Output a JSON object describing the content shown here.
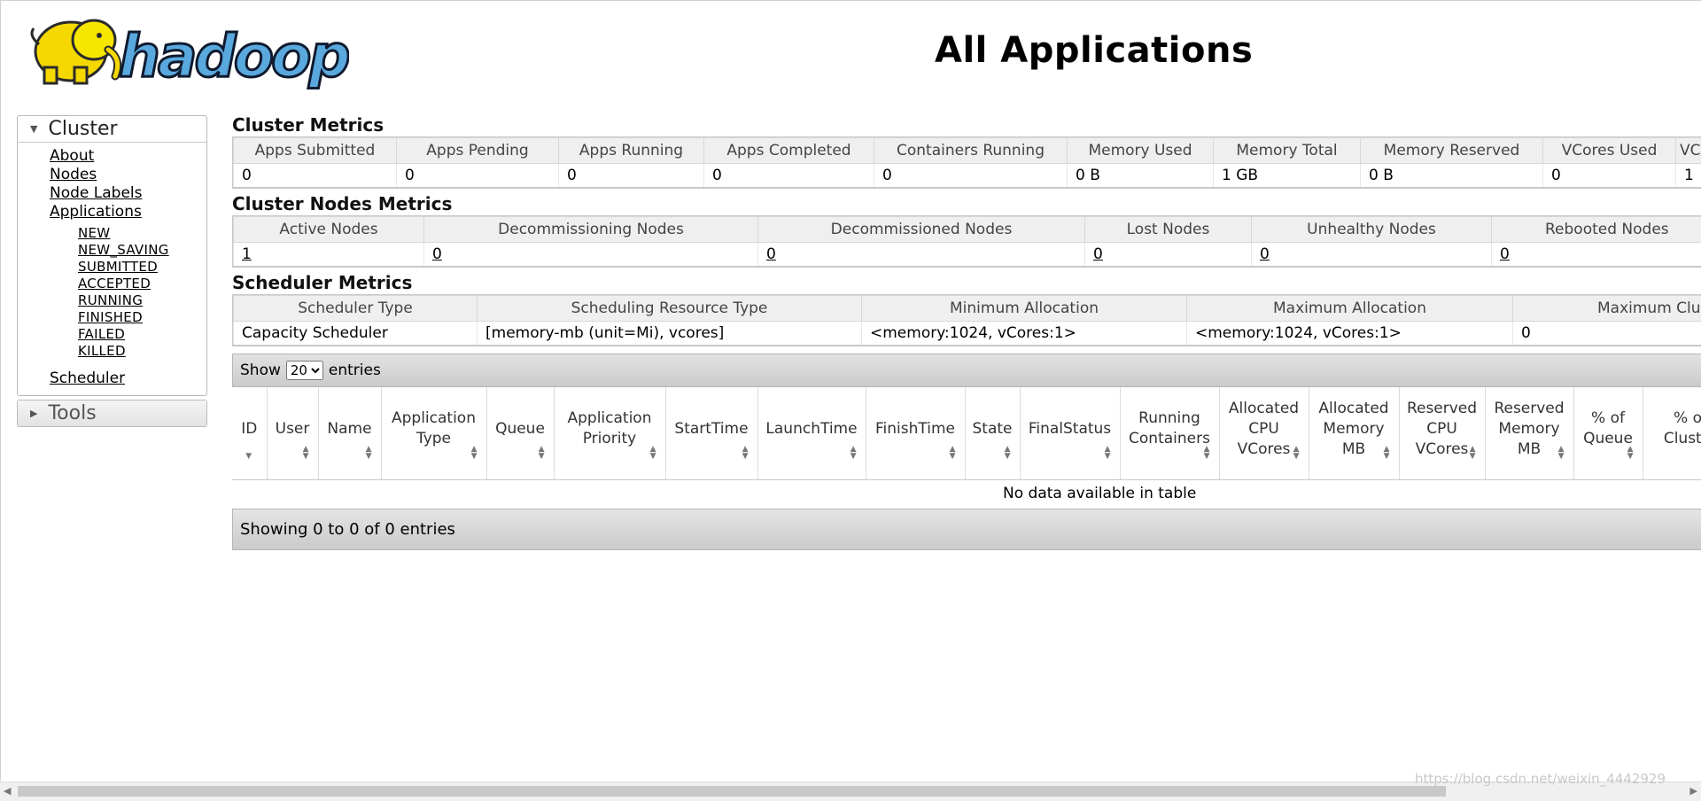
{
  "page": {
    "title": "All Applications",
    "logo_text": "hadoop"
  },
  "sidebar": {
    "cluster": {
      "header": "Cluster",
      "links": [
        "About",
        "Nodes",
        "Node Labels",
        "Applications"
      ],
      "app_states": [
        "NEW",
        "NEW_SAVING",
        "SUBMITTED",
        "ACCEPTED",
        "RUNNING",
        "FINISHED",
        "FAILED",
        "KILLED"
      ],
      "scheduler": "Scheduler"
    },
    "tools": {
      "header": "Tools"
    }
  },
  "cluster_metrics": {
    "title": "Cluster Metrics",
    "headers": [
      "Apps Submitted",
      "Apps Pending",
      "Apps Running",
      "Apps Completed",
      "Containers Running",
      "Memory Used",
      "Memory Total",
      "Memory Reserved",
      "VCores Used",
      "VC"
    ],
    "values": [
      "0",
      "0",
      "0",
      "0",
      "0",
      "0 B",
      "1 GB",
      "0 B",
      "0",
      "1"
    ]
  },
  "node_metrics": {
    "title": "Cluster Nodes Metrics",
    "headers": [
      "Active Nodes",
      "Decommissioning Nodes",
      "Decommissioned Nodes",
      "Lost Nodes",
      "Unhealthy Nodes",
      "Rebooted Nodes"
    ],
    "values": [
      "1",
      "0",
      "0",
      "0",
      "0",
      "0"
    ]
  },
  "scheduler_metrics": {
    "title": "Scheduler Metrics",
    "headers": [
      "Scheduler Type",
      "Scheduling Resource Type",
      "Minimum Allocation",
      "Maximum Allocation",
      "Maximum Clu"
    ],
    "values": [
      "Capacity Scheduler",
      "[memory-mb (unit=Mi), vcores]",
      "<memory:1024, vCores:1>",
      "<memory:1024, vCores:1>",
      "0"
    ]
  },
  "apps_table": {
    "show_label": "Show",
    "entries_label": "entries",
    "page_size": "20",
    "columns": [
      "ID",
      "User",
      "Name",
      "Application Type",
      "Queue",
      "Application Priority",
      "StartTime",
      "LaunchTime",
      "FinishTime",
      "State",
      "FinalStatus",
      "Running Containers",
      "Allocated CPU VCores",
      "Allocated Memory MB",
      "Reserved CPU VCores",
      "Reserved Memory MB",
      "% of Queue",
      "% of Cluster"
    ],
    "empty_message": "No data available in table",
    "info": "Showing 0 to 0 of 0 entries"
  },
  "watermark": "https://blog.csdn.net/weixin_4442929"
}
